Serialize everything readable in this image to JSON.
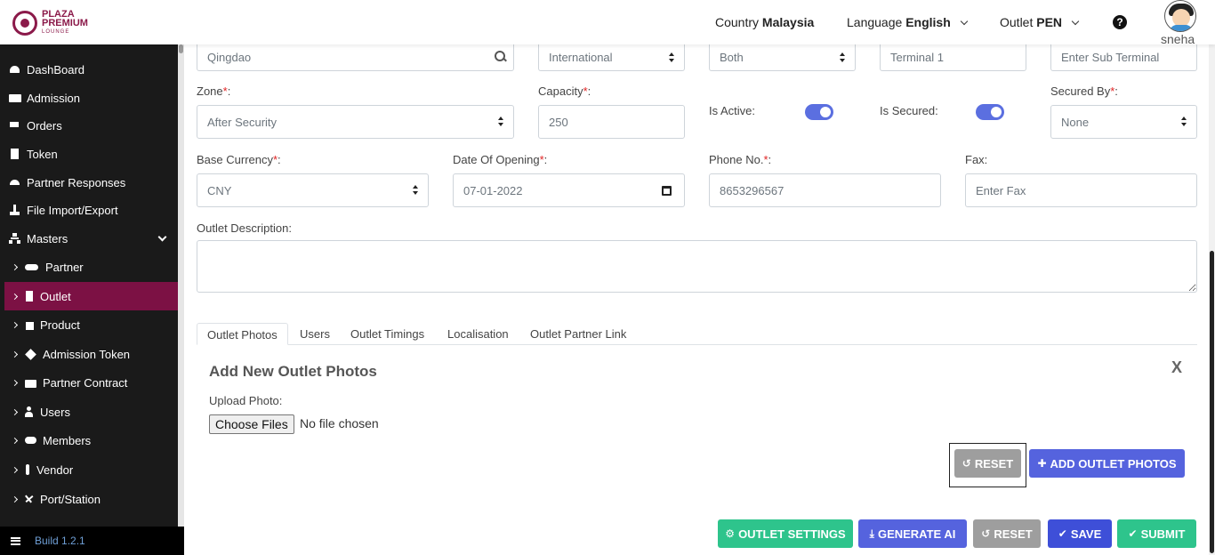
{
  "header": {
    "logo": {
      "line1": "PLAZA",
      "line2": "PREMIUM",
      "line3": "LOUNGE"
    },
    "country_label": "Country",
    "country_value": "Malaysia",
    "language_label": "Language",
    "language_value": "English",
    "outlet_label": "Outlet",
    "outlet_value": "PEN",
    "help_icon": "?",
    "username": "sneha"
  },
  "sidebar": {
    "items": [
      {
        "label": "DashBoard",
        "icon": "dashboard-icon"
      },
      {
        "label": "Admission",
        "icon": "id-card-icon"
      },
      {
        "label": "Orders",
        "icon": "cart-icon"
      },
      {
        "label": "Token",
        "icon": "file-icon"
      },
      {
        "label": "Partner Responses",
        "icon": "reply-icon"
      },
      {
        "label": "File Import/Export",
        "icon": "download-icon"
      },
      {
        "label": "Masters",
        "icon": "sitemap-icon"
      }
    ],
    "sub_items": [
      {
        "label": "Partner",
        "icon": "handshake-icon"
      },
      {
        "label": "Outlet",
        "icon": "building-icon"
      },
      {
        "label": "Product",
        "icon": "gift-icon"
      },
      {
        "label": "Admission Token",
        "icon": "ticket-icon"
      },
      {
        "label": "Partner Contract",
        "icon": "briefcase-icon"
      },
      {
        "label": "Users",
        "icon": "user-icon"
      },
      {
        "label": "Members",
        "icon": "users-icon"
      },
      {
        "label": "Vendor",
        "icon": "person-icon"
      },
      {
        "label": "Port/Station",
        "icon": "plane-icon"
      }
    ],
    "build": "Build 1.2.1"
  },
  "form": {
    "city_value": "Qingdao",
    "type_value": "International",
    "direction_value": "Both",
    "terminal_value": "Terminal 1",
    "sub_terminal_placeholder": "Enter Sub Terminal",
    "zone_label": "Zone",
    "zone_value": "After Security",
    "capacity_label": "Capacity",
    "capacity_value": "250",
    "is_active_label": "Is Active:",
    "is_active": true,
    "is_secured_label": "Is Secured:",
    "is_secured": true,
    "secured_by_label": "Secured By",
    "secured_by_value": "None",
    "base_currency_label": "Base Currency",
    "base_currency_value": "CNY",
    "date_opening_label": "Date Of Opening",
    "date_opening_value": "07-01-2022",
    "phone_label": "Phone No.",
    "phone_value": "8653296567",
    "fax_label": "Fax:",
    "fax_placeholder": "Enter Fax",
    "description_label": "Outlet Description:",
    "req_mark": "*",
    "colon": ":"
  },
  "tabs": [
    "Outlet Photos",
    "Users",
    "Outlet Timings",
    "Localisation",
    "Outlet Partner Link"
  ],
  "photos_panel": {
    "title": "Add New Outlet Photos",
    "close": "X",
    "upload_label": "Upload Photo:",
    "choose_files": "Choose Files",
    "no_file": "No file chosen",
    "reset": "RESET",
    "add": "ADD OUTLET PHOTOS"
  },
  "footer_buttons": {
    "outlet_settings": "OUTLET SETTINGS",
    "generate_ai": "GENERATE AI",
    "reset": "RESET",
    "save": "SAVE",
    "submit": "SUBMIT"
  },
  "colors": {
    "brand": "#7c1144",
    "primary": "#3e4fd8",
    "success": "#2ec48c",
    "toggle": "#5b6fe0"
  }
}
